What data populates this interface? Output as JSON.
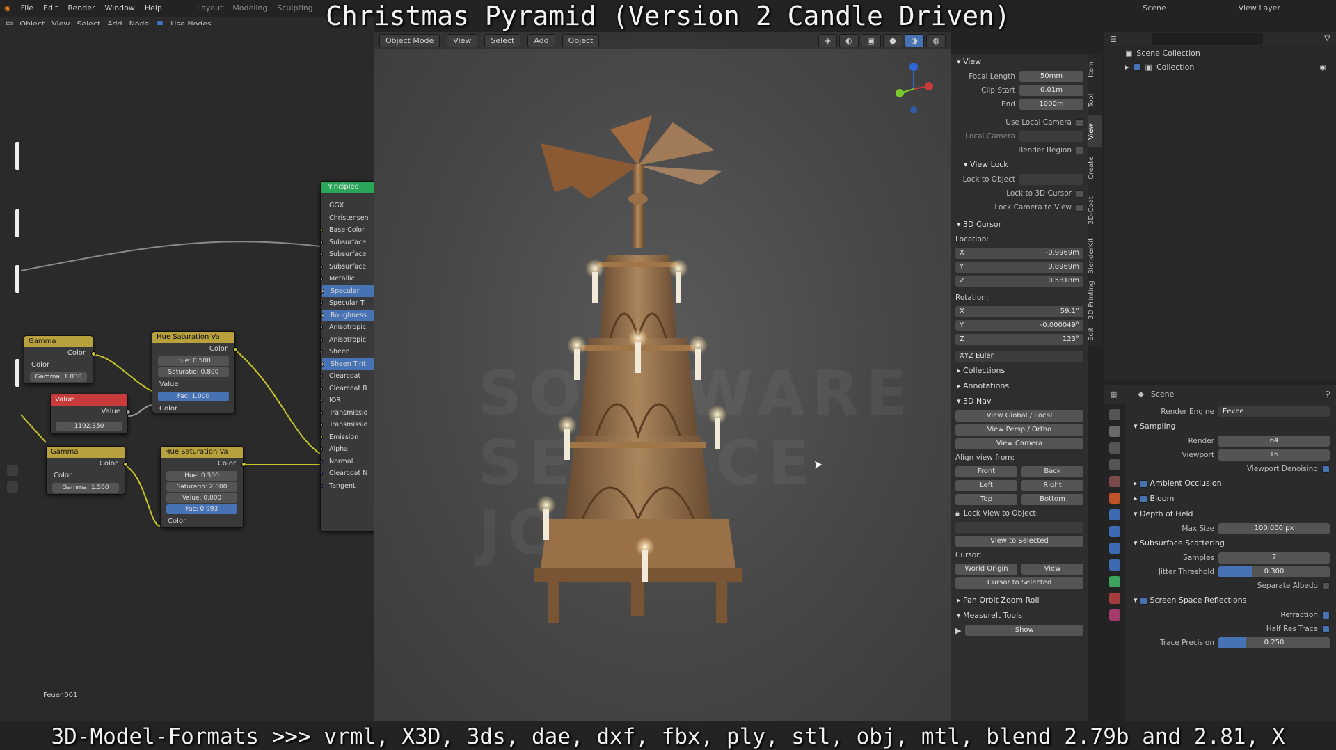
{
  "overlay": {
    "title": "Christmas Pyramid (Version 2 Candle Driven)",
    "caption": "3D-Model-Formats >>> vrml, X3D, 3ds, dae, dxf, fbx, ply, stl, obj, mtl, blend 2.79b and 2.81, X"
  },
  "topmenu": [
    "File",
    "Edit",
    "Render",
    "Window",
    "Help"
  ],
  "workspaces": [
    "Layout",
    "Modeling",
    "Sculpting"
  ],
  "scene_name": "Scene",
  "view_layer": "View Layer",
  "node_editor": {
    "header": [
      "Object",
      "View",
      "Select",
      "Add",
      "Node",
      "Use Nodes"
    ],
    "material_name": "Feuer.001",
    "nodes": {
      "gamma1": {
        "title": "Gamma",
        "out": "Color",
        "in": "Color",
        "field": "Gamma: 1.030"
      },
      "value": {
        "title": "Value",
        "out": "Value",
        "field": "1192.350"
      },
      "gamma2": {
        "title": "Gamma",
        "out": "Color",
        "in": "Color",
        "field": "Gamma: 1.500"
      },
      "hsv1": {
        "title": "Hue Saturation Va",
        "out": "Color",
        "hue": "Hue: 0.500",
        "sat": "Saturatio: 0.800",
        "val": "Value",
        "fac": "Fac: 1.000",
        "in": "Color"
      },
      "hsv2": {
        "title": "Hue Saturation Va",
        "out": "Color",
        "hue": "Hue: 0.500",
        "sat": "Saturatio: 2.000",
        "val": "Value: 0.000",
        "fac": "Fac: 0.993",
        "in": "Color"
      },
      "principled": {
        "title": "Principled",
        "rows": [
          "GGX",
          "Christensen",
          "Base Color",
          "Subsurface",
          "Subsurface",
          "Subsurface",
          "Metallic",
          "Specular",
          "Specular Ti",
          "Roughness",
          "Anisotropic",
          "Anisotropic",
          "Sheen",
          "Sheen Tint",
          "Clearcoat",
          "Clearcoat R",
          "IOR",
          "Transmissio",
          "Transmissio",
          "Emission",
          "Alpha",
          "Normal",
          "Clearcoat N",
          "Tangent"
        ]
      }
    }
  },
  "viewport": {
    "header": [
      "Object Mode",
      "View",
      "Select",
      "Add",
      "Object"
    ],
    "watermark": "SOFTWARE SERVICE JOHN"
  },
  "npanel": {
    "tabs": [
      "Item",
      "Tool",
      "View",
      "Create",
      "3D-Coat",
      "BlenderKit",
      "3D Printing",
      "Edit"
    ],
    "view_title": "View",
    "focal_label": "Focal Length",
    "focal": "50mm",
    "clip_start_label": "Clip Start",
    "clip_start": "0.01m",
    "end_label": "End",
    "end": "1000m",
    "use_local_camera": "Use Local Camera",
    "local_camera": "Local Camera",
    "render_region": "Render Region",
    "view_lock_title": "View Lock",
    "lock_to_object": "Lock to Object",
    "lock_to_cursor": "Lock to 3D Cursor",
    "lock_camera": "Lock Camera to View",
    "cursor_title": "3D Cursor",
    "location_label": "Location:",
    "loc": [
      {
        "k": "X",
        "v": "-0.9969m"
      },
      {
        "k": "Y",
        "v": "0.8969m"
      },
      {
        "k": "Z",
        "v": "0.5818m"
      }
    ],
    "rotation_label": "Rotation:",
    "rot": [
      {
        "k": "X",
        "v": "59.1°"
      },
      {
        "k": "Y",
        "v": "-0.000049°"
      },
      {
        "k": "Z",
        "v": "123°"
      }
    ],
    "euler": "XYZ Euler",
    "collections": "Collections",
    "annotations": "Annotations",
    "nav_title": "3D Nav",
    "view_global": "View Global / Local",
    "view_persp": "View Persp / Ortho",
    "view_camera": "View Camera",
    "align_from": "Align view from:",
    "front": "Front",
    "back": "Back",
    "left": "Left",
    "right": "Right",
    "top": "Top",
    "bottom": "Bottom",
    "lock_view_to_object": "Lock View to Object:",
    "view_to_selected": "View to Selected",
    "cursor_label": "Cursor:",
    "world_origin": "World Origin",
    "view": "View",
    "cursor_to_selected": "Cursor to Selected",
    "pan_orbit": "Pan Orbit Zoom Roll",
    "measureit": "MeasureIt Tools",
    "show": "Show"
  },
  "outliner": {
    "scene_collection": "Scene Collection",
    "collection": "Collection"
  },
  "properties": {
    "header": "Scene",
    "render_engine_label": "Render Engine",
    "render_engine": "Eevee",
    "sampling": "Sampling",
    "render_label": "Render",
    "render": "64",
    "viewport_label": "Viewport",
    "viewport": "16",
    "denoise": "Viewport Denoising",
    "ao": "Ambient Occlusion",
    "bloom": "Bloom",
    "dof": "Depth of Field",
    "max_size_label": "Max Size",
    "max_size": "100.000 px",
    "sss": "Subsurface Scattering",
    "samples_label": "Samples",
    "samples": "7",
    "jitter_label": "Jitter Threshold",
    "jitter": "0.300",
    "jitter_frac": 0.3,
    "sep_albedo": "Separate Albedo",
    "ssr": "Screen Space Reflections",
    "refraction": "Refraction",
    "half_res": "Half Res Trace",
    "trace_label": "Trace Precision",
    "trace": "0.250",
    "trace_frac": 0.25
  },
  "colors": {
    "accent": "#4772b3",
    "node_color": "#c7c729",
    "node_value": "#c93b3b",
    "node_shader": "#29a65a"
  }
}
